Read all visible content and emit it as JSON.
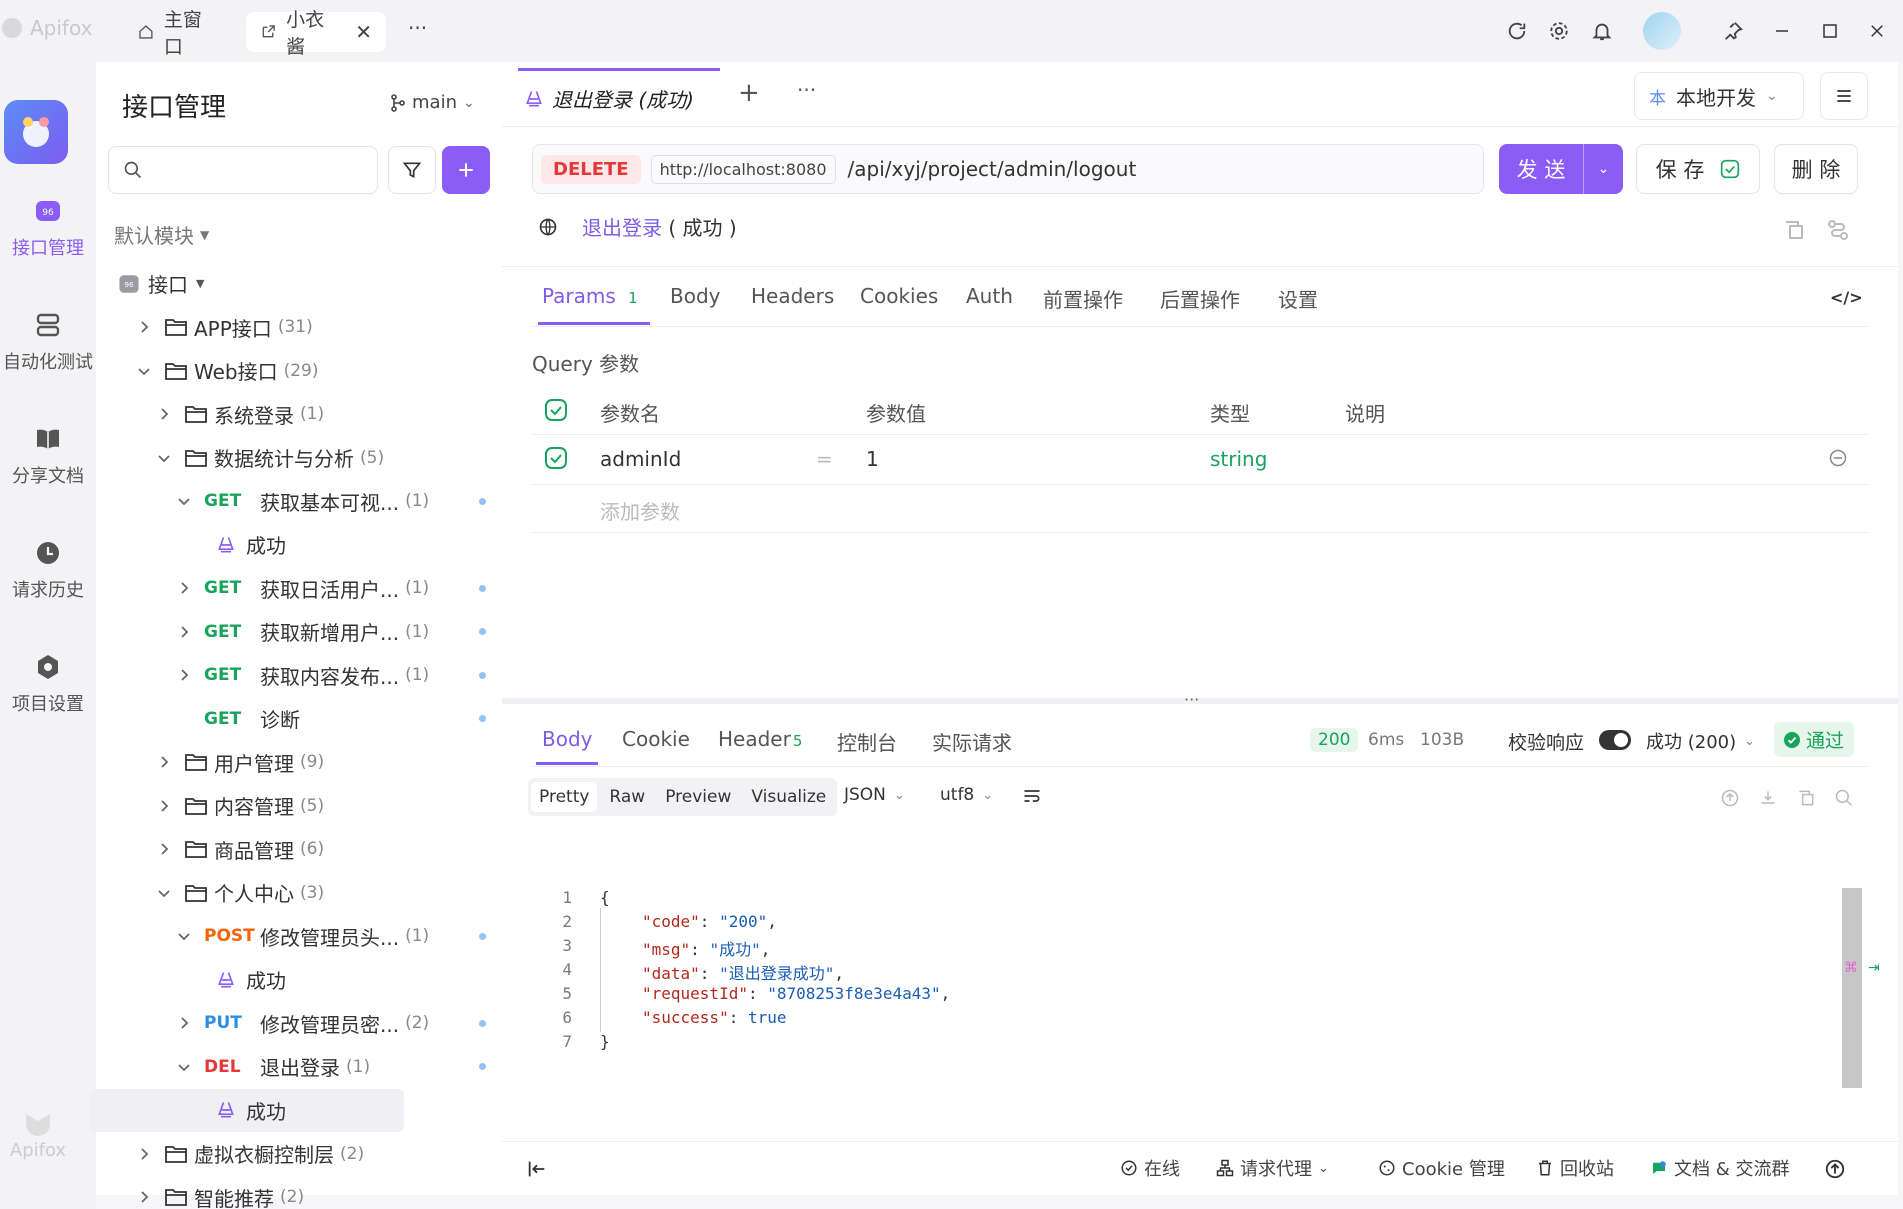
{
  "app": {
    "name": "Apifox"
  },
  "titlebar": {
    "tabs": [
      {
        "label": "主窗口"
      },
      {
        "label": "小衣酱"
      }
    ],
    "more": "···"
  },
  "rail": {
    "items": [
      {
        "label": "接口管理",
        "icon": "api-icon",
        "active": true
      },
      {
        "label": "自动化测试",
        "icon": "automation-icon"
      },
      {
        "label": "分享文档",
        "icon": "book-icon"
      },
      {
        "label": "请求历史",
        "icon": "clock-icon"
      },
      {
        "label": "项目设置",
        "icon": "settings-icon"
      }
    ],
    "footer_logo": "Apifox"
  },
  "sidebar": {
    "title": "接口管理",
    "branch": "main",
    "search_placeholder": "",
    "module": "默认模块",
    "tree": [
      {
        "type": "root",
        "label": "接口"
      },
      {
        "type": "folder",
        "label": "APP接口",
        "count": "(31)",
        "expanded": false
      },
      {
        "type": "folder",
        "label": "Web接口",
        "count": "(29)",
        "expanded": true
      },
      {
        "type": "folder",
        "label": "系统登录",
        "count": "(1)",
        "expanded": false
      },
      {
        "type": "folder",
        "label": "数据统计与分析",
        "count": "(5)",
        "expanded": true
      },
      {
        "type": "api",
        "method": "GET",
        "label": "获取基本可视...",
        "count": "(1)"
      },
      {
        "type": "case",
        "label": "成功"
      },
      {
        "type": "api",
        "method": "GET",
        "label": "获取日活用户...",
        "count": "(1)"
      },
      {
        "type": "api",
        "method": "GET",
        "label": "获取新增用户...",
        "count": "(1)"
      },
      {
        "type": "api",
        "method": "GET",
        "label": "获取内容发布...",
        "count": "(1)"
      },
      {
        "type": "api",
        "method": "GET",
        "label": "诊断",
        "count": ""
      },
      {
        "type": "folder",
        "label": "用户管理",
        "count": "(9)",
        "expanded": false
      },
      {
        "type": "folder",
        "label": "内容管理",
        "count": "(5)",
        "expanded": false
      },
      {
        "type": "folder",
        "label": "商品管理",
        "count": "(6)",
        "expanded": false
      },
      {
        "type": "folder",
        "label": "个人中心",
        "count": "(3)",
        "expanded": true
      },
      {
        "type": "api",
        "method": "POST",
        "label": "修改管理员头...",
        "count": "(1)"
      },
      {
        "type": "case",
        "label": "成功"
      },
      {
        "type": "api",
        "method": "PUT",
        "label": "修改管理员密...",
        "count": "(2)"
      },
      {
        "type": "api",
        "method": "DEL",
        "label": "退出登录",
        "count": "(1)"
      },
      {
        "type": "case",
        "label": "成功",
        "selected": true
      },
      {
        "type": "folder",
        "label": "虚拟衣橱控制层",
        "count": "(2)",
        "expanded": false
      },
      {
        "type": "folder",
        "label": "智能推荐",
        "count": "(2)",
        "expanded": false
      }
    ]
  },
  "doc_tab": {
    "title": "退出登录 (成功)"
  },
  "env": {
    "badge": "本",
    "label": "本地开发"
  },
  "request": {
    "method": "DELETE",
    "base_url": "http://localhost:8080",
    "path": "/api/xyj/project/admin/logout",
    "send": "发 送",
    "save": "保 存",
    "delete": "删 除",
    "name": "退出登录",
    "case": "( 成功 )"
  },
  "param_tabs": [
    {
      "label": "Params",
      "badge": "1",
      "active": true
    },
    {
      "label": "Body"
    },
    {
      "label": "Headers"
    },
    {
      "label": "Cookies"
    },
    {
      "label": "Auth"
    },
    {
      "label": "前置操作"
    },
    {
      "label": "后置操作"
    },
    {
      "label": "设置"
    }
  ],
  "query": {
    "title": "Query 参数",
    "headers": [
      "参数名",
      "参数值",
      "类型",
      "说明"
    ],
    "rows": [
      {
        "name": "adminId",
        "eq": "=",
        "value": "1",
        "type": "string",
        "desc": ""
      }
    ],
    "add_placeholder": "添加参数"
  },
  "response": {
    "tabs": [
      {
        "label": "Body",
        "active": true
      },
      {
        "label": "Cookie"
      },
      {
        "label": "Header",
        "badge": "5"
      },
      {
        "label": "控制台"
      },
      {
        "label": "实际请求"
      }
    ],
    "status": "200",
    "time": "6ms",
    "size": "103B",
    "validate_label": "校验响应",
    "validate_case": "成功 (200)",
    "result": "通过",
    "view_tabs": [
      "Pretty",
      "Raw",
      "Preview",
      "Visualize"
    ],
    "format": "JSON",
    "encoding": "utf8",
    "lines": [
      {
        "n": "1",
        "text": "{"
      },
      {
        "n": "2",
        "key": "\"code\"",
        "val": "\"200\"",
        "comma": ","
      },
      {
        "n": "3",
        "key": "\"msg\"",
        "val": "\"成功\"",
        "comma": ","
      },
      {
        "n": "4",
        "key": "\"data\"",
        "val": "\"退出登录成功\"",
        "comma": ","
      },
      {
        "n": "5",
        "key": "\"requestId\"",
        "val": "\"8708253f8e3e4a43\"",
        "comma": ","
      },
      {
        "n": "6",
        "key": "\"success\"",
        "val": "true",
        "comma": ""
      },
      {
        "n": "7",
        "text": "}"
      }
    ]
  },
  "statusbar": {
    "online": "在线",
    "proxy": "请求代理",
    "cookie": "Cookie 管理",
    "trash": "回收站",
    "docs": "文档 & 交流群"
  },
  "colors": {
    "accent": "#8b5cf6",
    "success": "#19a35c",
    "danger": "#e5383b"
  }
}
